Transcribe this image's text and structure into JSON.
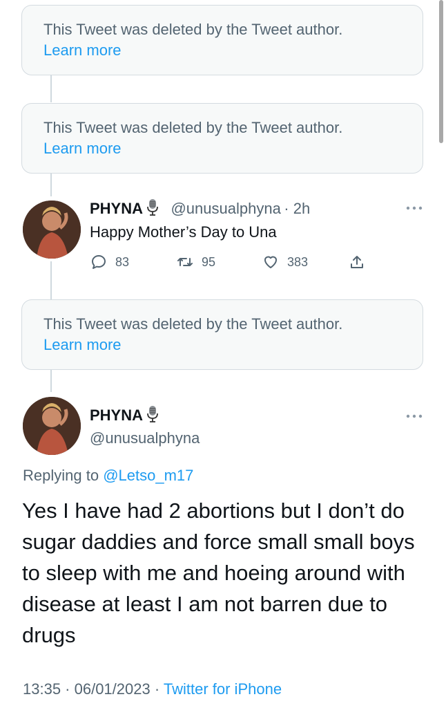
{
  "deleted_tweets": [
    {
      "text": "This Tweet was deleted by the Tweet author.",
      "link": "Learn more"
    },
    {
      "text": "This Tweet was deleted by the Tweet author.",
      "link": "Learn more"
    },
    {
      "text": "This Tweet was deleted by the Tweet author.",
      "link": "Learn more"
    }
  ],
  "tweet1": {
    "name": "PHYNA",
    "handle": "@unusualphyna",
    "time": "· 2h",
    "text": "Happy Mother’s Day to Una",
    "replies": "83",
    "retweets": "95",
    "likes": "383"
  },
  "tweet2": {
    "name": "PHYNA",
    "handle": "@unusualphyna",
    "replying_prefix": "Replying to ",
    "replying_to": "@Letso_m17",
    "text": "Yes I have had 2 abortions but I don’t do sugar daddies and force small small boys to sleep with me and hoeing around with disease at least I am not barren due to drugs",
    "timestamp": "13:35 · 06/01/2023 · ",
    "source": "Twitter for iPhone"
  },
  "icons": {
    "reply": "reply-icon",
    "retweet": "retweet-icon",
    "like": "heart-icon",
    "share": "share-icon",
    "more": "more-icon",
    "verified_emoji": "microphone-icon"
  },
  "colors": {
    "link": "#1d9bf0",
    "secondary": "#536471",
    "primary": "#0f1419"
  }
}
